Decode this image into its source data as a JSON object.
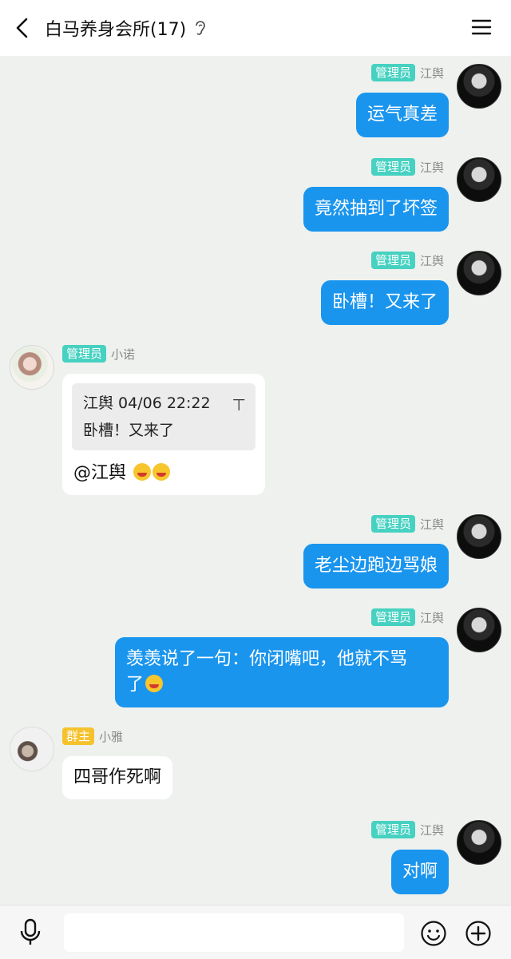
{
  "header": {
    "title": "白马养身会所(17)",
    "back_icon": "back-arrow-icon",
    "ear_icon": "ear-icon",
    "menu_icon": "menu-icon"
  },
  "messages": [
    {
      "side": "out",
      "role": "管理员",
      "name": "江舆",
      "text": "运气真差"
    },
    {
      "side": "out",
      "role": "管理员",
      "name": "江舆",
      "text": "竟然抽到了坏签"
    },
    {
      "side": "out",
      "role": "管理员",
      "name": "江舆",
      "text": "卧槽！又来了"
    },
    {
      "side": "in",
      "role": "管理员",
      "name": "小诺",
      "quote_header": "江舆 04/06 22:22",
      "quote_text": "卧槽！又来了",
      "text": "@江舆",
      "emoji_icon": "laughing-emoji-icon"
    },
    {
      "side": "out",
      "role": "管理员",
      "name": "江舆",
      "text": "老尘边跑边骂娘"
    },
    {
      "side": "out",
      "role": "管理员",
      "name": "江舆",
      "line1": "羡羡说了一句：你闭嘴吧，他就不骂",
      "line2": "了"
    },
    {
      "side": "in",
      "role": "群主",
      "name": "小雅",
      "text": "四哥作死啊"
    },
    {
      "side": "out",
      "role": "管理员",
      "name": "江舆",
      "text": "对啊"
    }
  ],
  "input": {
    "value": "",
    "mic_icon": "microphone-icon",
    "emoji_icon": "smiley-icon",
    "plus_icon": "plus-circle-icon"
  },
  "colors": {
    "background": "#eef1ee",
    "bubble_out": "#1a95ee",
    "badge_admin": "#46d1c1",
    "badge_owner": "#f5c22e"
  }
}
